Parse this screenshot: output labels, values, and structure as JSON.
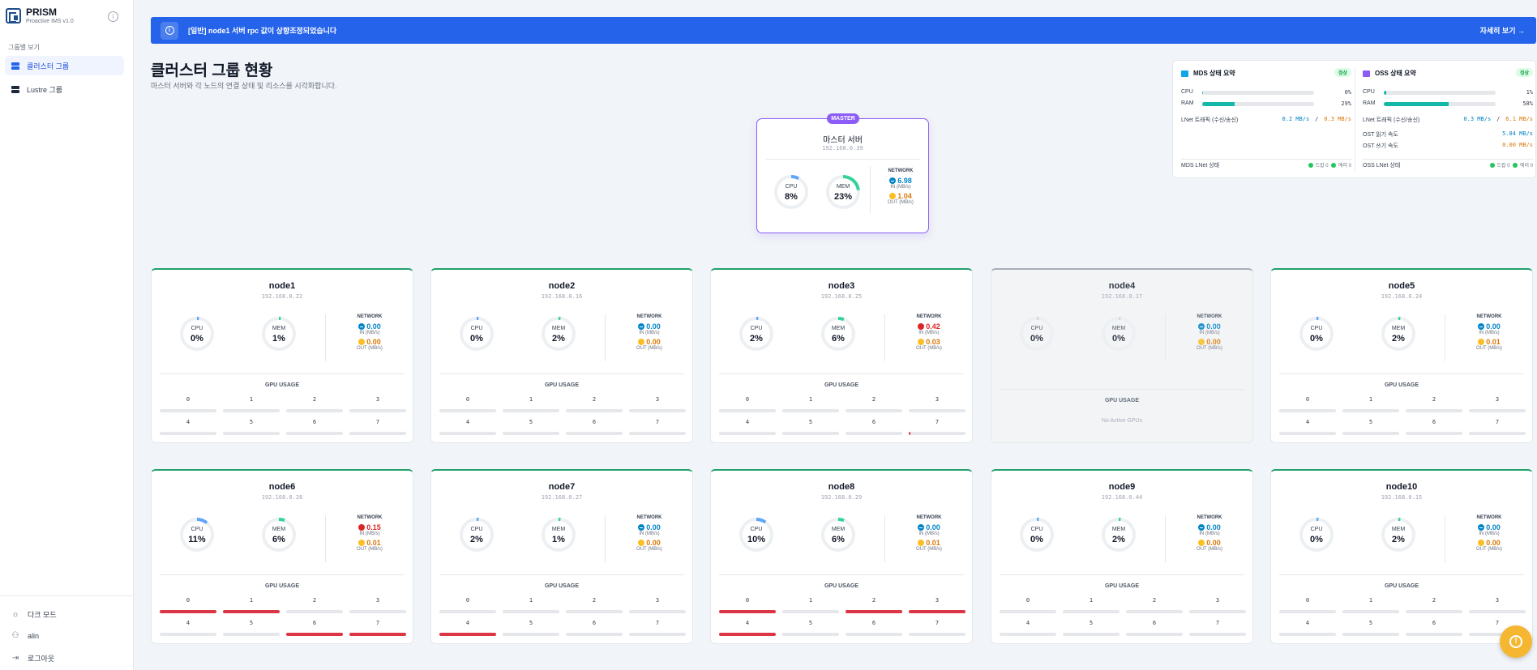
{
  "app": {
    "name": "PRISM",
    "subtitle": "Proactive IMS v1.0"
  },
  "sidebar": {
    "section_label": "그룹별 보기",
    "items": [
      {
        "label": "클러스터 그룹",
        "active": true,
        "icon": "server-icon"
      },
      {
        "label": "Lustre 그룹",
        "active": false,
        "icon": "server-icon"
      }
    ],
    "bottom": {
      "dark_mode": "다크 모드",
      "user": "alin",
      "logout": "로그아웃"
    }
  },
  "banner": {
    "text": "[일반] node1 서버 rpc 값이 상향조정되었습니다",
    "link": "자세히 보기 →",
    "color": "#2563eb"
  },
  "header": {
    "title": "클러스터 그룹 현황",
    "subtitle": "마스터 서버와 각 노드의 연결 상태 및 리소스를 시각화합니다."
  },
  "master": {
    "badge": "MASTER",
    "name": "마스터 서버",
    "ip": "192.168.0.39",
    "cpu_label": "CPU",
    "cpu": "8%",
    "cpu_frac": 0.08,
    "mem_label": "MEM",
    "mem": "23%",
    "mem_frac": 0.23,
    "network_label": "NETWORK",
    "in": "6.98",
    "in_unit": "IN (MB/s)",
    "out": "1.04",
    "out_unit": "OUT (MB/s)"
  },
  "summary": {
    "mds": {
      "title": "MDS 상태 요약",
      "status": "정상",
      "cpu_label": "CPU",
      "cpu": "0%",
      "cpu_frac": 0.0,
      "ram_label": "RAM",
      "ram": "29%",
      "ram_frac": 0.29,
      "lnet_label": "LNet 트래픽 (수신/송신)",
      "lnet_in": "0.2 MB/s",
      "sep": "/",
      "lnet_out": "0.3 MB/s",
      "lnet_status_label": "MDS LNet 상태",
      "lnet_status_a": "드랍 0",
      "lnet_status_b": "에러 0"
    },
    "oss": {
      "title": "OSS 상태 요약",
      "status": "정상",
      "cpu_label": "CPU",
      "cpu": "1%",
      "cpu_frac": 0.01,
      "ram_label": "RAM",
      "ram": "58%",
      "ram_frac": 0.58,
      "lnet_label": "LNet 트래픽 (수신/송신)",
      "lnet_in": "0.3 MB/s",
      "sep": "/",
      "lnet_out": "6.1 MB/s",
      "read_label": "OST 읽기 속도",
      "read": "5.84 MB/s",
      "write_label": "OST 쓰기 속도",
      "write": "0.00 MB/s",
      "lnet_status_label": "OSS LNet 상태",
      "lnet_status_a": "드랍 0",
      "lnet_status_b": "에러 0"
    }
  },
  "labels": {
    "cpu": "CPU",
    "mem": "MEM",
    "network": "NETWORK",
    "in_unit": "IN (MB/s)",
    "out_unit": "OUT (MB/s)",
    "gpu_usage": "GPU USAGE",
    "no_gpu": "No Active GPUs"
  },
  "nodes": [
    {
      "name": "node1",
      "ip": "192.168.0.22",
      "cpu": "0%",
      "cpu_frac": 0.0,
      "mem": "1%",
      "mem_frac": 0.01,
      "in": "0.00",
      "in_status": "in",
      "out": "0.00",
      "online": true,
      "gpus": [
        0,
        0,
        0,
        0,
        0,
        0,
        0,
        0
      ]
    },
    {
      "name": "node2",
      "ip": "192.168.0.16",
      "cpu": "0%",
      "cpu_frac": 0.0,
      "mem": "2%",
      "mem_frac": 0.02,
      "in": "0.00",
      "in_status": "in",
      "out": "0.00",
      "online": true,
      "gpus": [
        0,
        0,
        0,
        0,
        0,
        0,
        0,
        0
      ]
    },
    {
      "name": "node3",
      "ip": "192.168.0.25",
      "cpu": "2%",
      "cpu_frac": 0.02,
      "mem": "6%",
      "mem_frac": 0.06,
      "in": "0.42",
      "in_status": "err",
      "out": "0.03",
      "online": true,
      "gpus": [
        0,
        0,
        0,
        0,
        0,
        0,
        0,
        0.03
      ]
    },
    {
      "name": "node4",
      "ip": "192.168.0.17",
      "cpu": "0%",
      "cpu_frac": 0.0,
      "mem": "0%",
      "mem_frac": 0.0,
      "in": "0.00",
      "in_status": "in",
      "out": "0.00",
      "online": false,
      "gpus": []
    },
    {
      "name": "node5",
      "ip": "192.168.0.24",
      "cpu": "0%",
      "cpu_frac": 0.0,
      "mem": "2%",
      "mem_frac": 0.02,
      "in": "0.00",
      "in_status": "in",
      "out": "0.01",
      "online": true,
      "gpus": [
        0,
        0,
        0,
        0,
        0,
        0,
        0,
        0
      ]
    },
    {
      "name": "node6",
      "ip": "192.168.0.28",
      "cpu": "11%",
      "cpu_frac": 0.11,
      "mem": "6%",
      "mem_frac": 0.06,
      "in": "0.15",
      "in_status": "err",
      "out": "0.01",
      "online": true,
      "gpus": [
        1,
        1,
        0,
        0,
        0,
        0,
        1,
        1
      ]
    },
    {
      "name": "node7",
      "ip": "192.168.0.27",
      "cpu": "2%",
      "cpu_frac": 0.02,
      "mem": "1%",
      "mem_frac": 0.01,
      "in": "0.00",
      "in_status": "in",
      "out": "0.00",
      "online": true,
      "gpus": [
        0,
        0,
        0,
        0,
        1,
        0,
        0,
        0
      ]
    },
    {
      "name": "node8",
      "ip": "192.168.0.29",
      "cpu": "10%",
      "cpu_frac": 0.1,
      "mem": "6%",
      "mem_frac": 0.06,
      "in": "0.00",
      "in_status": "in",
      "out": "0.01",
      "online": true,
      "gpus": [
        1,
        0,
        1,
        1,
        1,
        0,
        0,
        0
      ]
    },
    {
      "name": "node9",
      "ip": "192.168.0.44",
      "cpu": "0%",
      "cpu_frac": 0.0,
      "mem": "2%",
      "mem_frac": 0.02,
      "in": "0.00",
      "in_status": "in",
      "out": "0.00",
      "online": true,
      "gpus": [
        0,
        0,
        0,
        0,
        0,
        0,
        0,
        0
      ]
    },
    {
      "name": "node10",
      "ip": "192.168.0.15",
      "cpu": "0%",
      "cpu_frac": 0.0,
      "mem": "2%",
      "mem_frac": 0.02,
      "in": "0.00",
      "in_status": "in",
      "out": "0.00",
      "online": true,
      "gpus": [
        0,
        0,
        0,
        0,
        0,
        0,
        0,
        0
      ]
    }
  ],
  "gpu_indices": [
    "0",
    "1",
    "2",
    "3",
    "4",
    "5",
    "6",
    "7"
  ],
  "colors": {
    "accent": "#2563eb",
    "cpu_gauge": "#60a5fa",
    "mem_gauge": "#34d399",
    "gpu_bar": "#dc3545",
    "online_border": "#22a06b",
    "master": "#8b5cf6"
  }
}
